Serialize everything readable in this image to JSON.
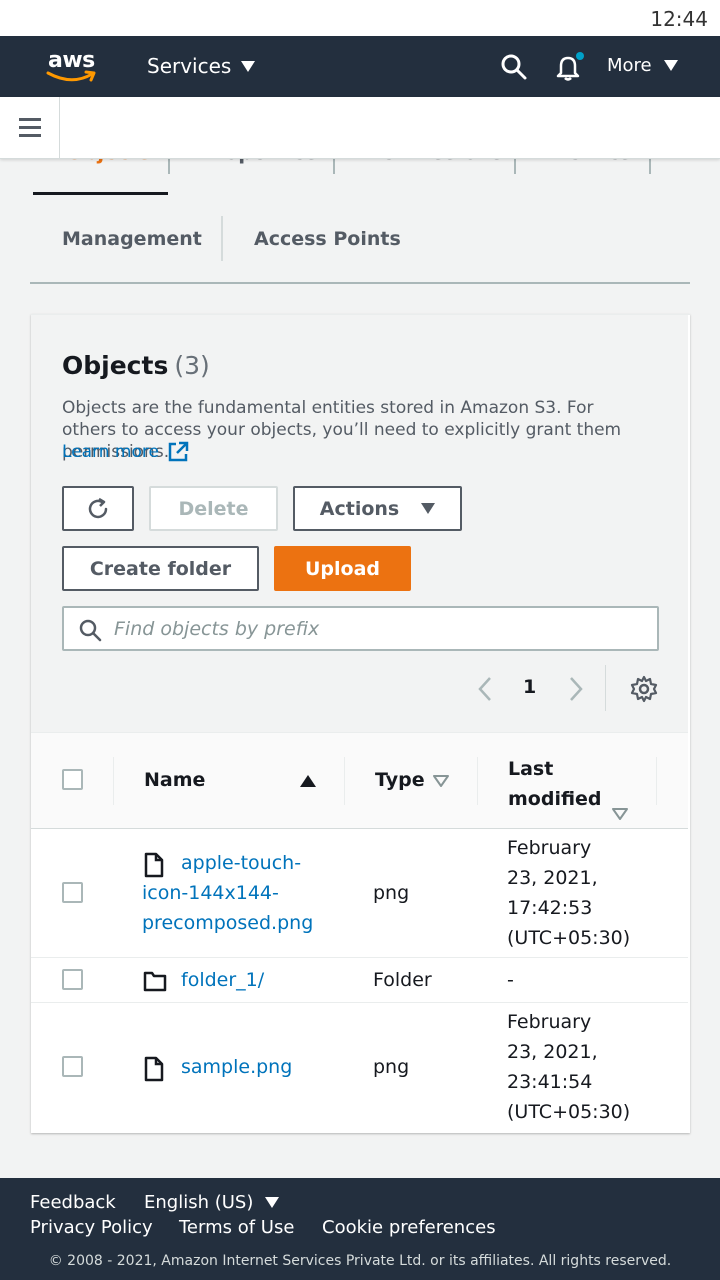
{
  "status": {
    "time": "12:44"
  },
  "topnav": {
    "logo": "aws",
    "services_label": "Services",
    "more_label": "More",
    "notification_dot_color": "#00a1c9"
  },
  "tabs": {
    "partial": [
      "Objects",
      "Properties",
      "Permissions",
      "Metrics"
    ],
    "row2": [
      "Management",
      "Access Points"
    ]
  },
  "objects": {
    "title": "Objects",
    "count": "(3)",
    "description": "Objects are the fundamental entities stored in Amazon S3. For others to access your objects, you’ll need to explicitly grant them permissions.",
    "learn_more": "Learn more",
    "buttons": {
      "delete": "Delete",
      "actions": "Actions",
      "create_folder": "Create folder",
      "upload": "Upload"
    },
    "search_placeholder": "Find objects by prefix",
    "page": "1"
  },
  "table": {
    "columns": {
      "name": "Name",
      "type": "Type",
      "last_modified_1": "Last",
      "last_modified_2": "modified"
    },
    "rows": [
      {
        "name_lines": [
          "apple-touch-",
          "icon-144x144-",
          "precomposed.png"
        ],
        "type": "png",
        "modified_lines": [
          "February",
          "23, 2021,",
          "17:42:53",
          "(UTC+05:30)"
        ],
        "icon": "file-icon"
      },
      {
        "name_lines": [
          "folder_1/"
        ],
        "type": "Folder",
        "modified_lines": [
          "-"
        ],
        "icon": "folder-icon"
      },
      {
        "name_lines": [
          "sample.png"
        ],
        "type": "png",
        "modified_lines": [
          "February",
          "23, 2021,",
          "23:41:54",
          "(UTC+05:30)"
        ],
        "icon": "file-icon"
      }
    ]
  },
  "footer": {
    "feedback": "Feedback",
    "language": "English (US)",
    "privacy": "Privacy Policy",
    "terms": "Terms of Use",
    "cookies": "Cookie preferences",
    "copyright": "© 2008 - 2021, Amazon Internet Services Private Ltd. or its affiliates. All rights reserved."
  },
  "colors": {
    "primary": "#ec7211",
    "link": "#0073bb",
    "nav_bg": "#232f3e"
  }
}
